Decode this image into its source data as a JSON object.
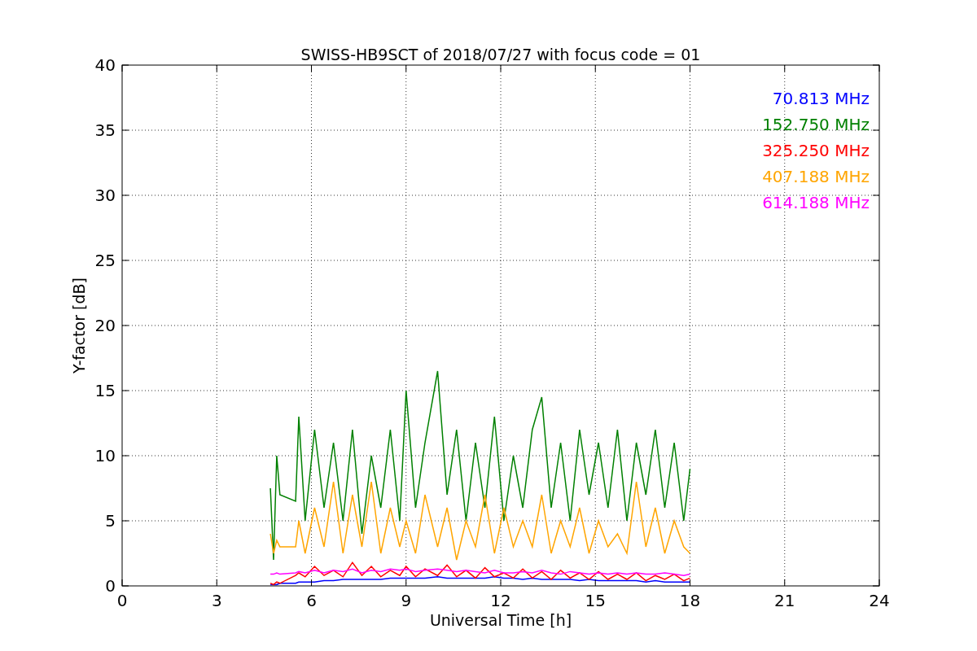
{
  "chart_data": {
    "type": "line",
    "title": "SWISS-HB9SCT of 2018/07/27 with focus code = 01",
    "xlabel": "Universal Time [h]",
    "ylabel": "Y-factor [dB]",
    "xlim": [
      0,
      24
    ],
    "ylim": [
      0,
      40
    ],
    "xticks": [
      0,
      3,
      6,
      9,
      12,
      15,
      18,
      21,
      24
    ],
    "yticks": [
      0,
      5,
      10,
      15,
      20,
      25,
      30,
      35,
      40
    ],
    "grid": true,
    "x": [
      4.7,
      4.8,
      4.9,
      5.0,
      5.5,
      5.6,
      5.8,
      6.1,
      6.4,
      6.7,
      7.0,
      7.3,
      7.6,
      7.9,
      8.2,
      8.5,
      8.8,
      9.0,
      9.3,
      9.6,
      10.0,
      10.3,
      10.6,
      10.9,
      11.2,
      11.5,
      11.8,
      12.1,
      12.4,
      12.7,
      13.0,
      13.3,
      13.6,
      13.9,
      14.2,
      14.5,
      14.8,
      15.1,
      15.4,
      15.7,
      16.0,
      16.3,
      16.6,
      16.9,
      17.2,
      17.5,
      17.8,
      18.0
    ],
    "series": [
      {
        "name": "70.813 MHz",
        "color": "#0000ff",
        "values": [
          0.1,
          0.1,
          0.1,
          0.2,
          0.2,
          0.3,
          0.3,
          0.3,
          0.4,
          0.4,
          0.5,
          0.5,
          0.5,
          0.5,
          0.5,
          0.6,
          0.6,
          0.6,
          0.6,
          0.6,
          0.7,
          0.6,
          0.6,
          0.6,
          0.6,
          0.6,
          0.7,
          0.6,
          0.6,
          0.5,
          0.6,
          0.5,
          0.5,
          0.5,
          0.5,
          0.4,
          0.5,
          0.4,
          0.4,
          0.4,
          0.4,
          0.4,
          0.3,
          0.4,
          0.3,
          0.3,
          0.3,
          0.3
        ]
      },
      {
        "name": "152.750 MHz",
        "color": "#008000",
        "values": [
          7.5,
          2,
          10,
          7,
          6.5,
          13,
          5,
          12,
          6,
          11,
          5,
          12,
          4,
          10,
          6,
          12,
          5,
          15,
          6,
          11,
          16.5,
          7,
          12,
          5,
          11,
          6,
          13,
          5,
          10,
          6,
          12,
          14.5,
          6,
          11,
          5,
          12,
          7,
          11,
          6,
          12,
          5,
          11,
          7,
          12,
          6,
          11,
          5,
          9
        ]
      },
      {
        "name": "325.250 MHz",
        "color": "#ff0000",
        "values": [
          0.2,
          0.1,
          0.3,
          0.2,
          0.8,
          1,
          0.7,
          1.5,
          0.8,
          1.2,
          0.7,
          1.8,
          0.8,
          1.5,
          0.7,
          1.2,
          0.8,
          1.5,
          0.7,
          1.3,
          0.8,
          1.6,
          0.7,
          1.2,
          0.6,
          1.4,
          0.7,
          1,
          0.6,
          1.3,
          0.6,
          1.1,
          0.5,
          1.2,
          0.6,
          1,
          0.5,
          1.1,
          0.5,
          0.9,
          0.5,
          1,
          0.4,
          0.8,
          0.5,
          0.9,
          0.4,
          0.6
        ]
      },
      {
        "name": "407.188 MHz",
        "color": "#ffa500",
        "values": [
          4,
          2.5,
          3.5,
          3,
          3,
          5,
          2.5,
          6,
          3,
          8,
          2.5,
          7,
          3,
          8,
          2.5,
          6,
          3,
          5,
          2.5,
          7,
          3,
          6,
          2,
          5,
          3,
          7,
          2.5,
          6,
          3,
          5,
          3,
          7,
          2.5,
          5,
          3,
          6,
          2.5,
          5,
          3,
          4,
          2.5,
          8,
          3,
          6,
          2.5,
          5,
          3,
          2.5
        ]
      },
      {
        "name": "614.188 MHz",
        "color": "#ff00ff",
        "values": [
          0.9,
          0.9,
          1,
          0.9,
          1,
          1.1,
          1,
          1.2,
          1,
          1.2,
          1.1,
          1.3,
          1,
          1.2,
          1.1,
          1.3,
          1.2,
          1.3,
          1.1,
          1.2,
          1.3,
          1.2,
          1.1,
          1.2,
          1.1,
          1,
          1.2,
          1,
          1,
          1.1,
          1,
          1.2,
          1,
          0.9,
          1.1,
          1,
          0.9,
          1,
          0.9,
          1,
          0.9,
          1,
          0.9,
          0.9,
          1,
          0.9,
          0.8,
          0.9
        ]
      }
    ]
  }
}
